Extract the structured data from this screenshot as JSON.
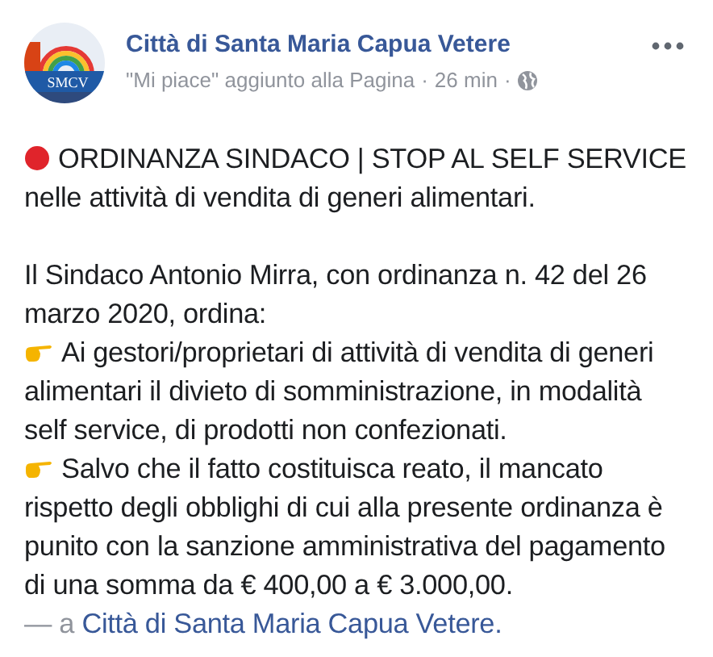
{
  "post": {
    "avatar_text": "SMCV",
    "author": "Città di Santa Maria Capua Vetere",
    "activity": "\"Mi piace\" aggiunto alla Pagina",
    "time": "26 min",
    "separator": "·"
  },
  "body": [
    {
      "kind": "heading",
      "text": "ORDINANZA SINDACO | STOP AL SELF SERVICE nelle attività di vendita di generi alimentari."
    },
    {
      "kind": "text",
      "text": "Il Sindaco Antonio Mirra, con ordinanza n. 42 del 26 marzo 2020, ordina:"
    },
    {
      "kind": "point",
      "text": "Ai gestori/proprietari di attività di vendita di generi alimentari il divieto di somministrazione, in modalità self service, di prodotti non confezionati."
    },
    {
      "kind": "point",
      "text": "Salvo che il fatto costituisca reato, il mancato rispetto degli obblighi di cui alla presente ordinanza è punito con la sanzione amministrativa del pagamento di una somma da € 400,00 a € 3.000,00."
    },
    {
      "kind": "tag",
      "prefix": "— a",
      "link": "Città di Santa Maria Capua Vetere."
    }
  ]
}
